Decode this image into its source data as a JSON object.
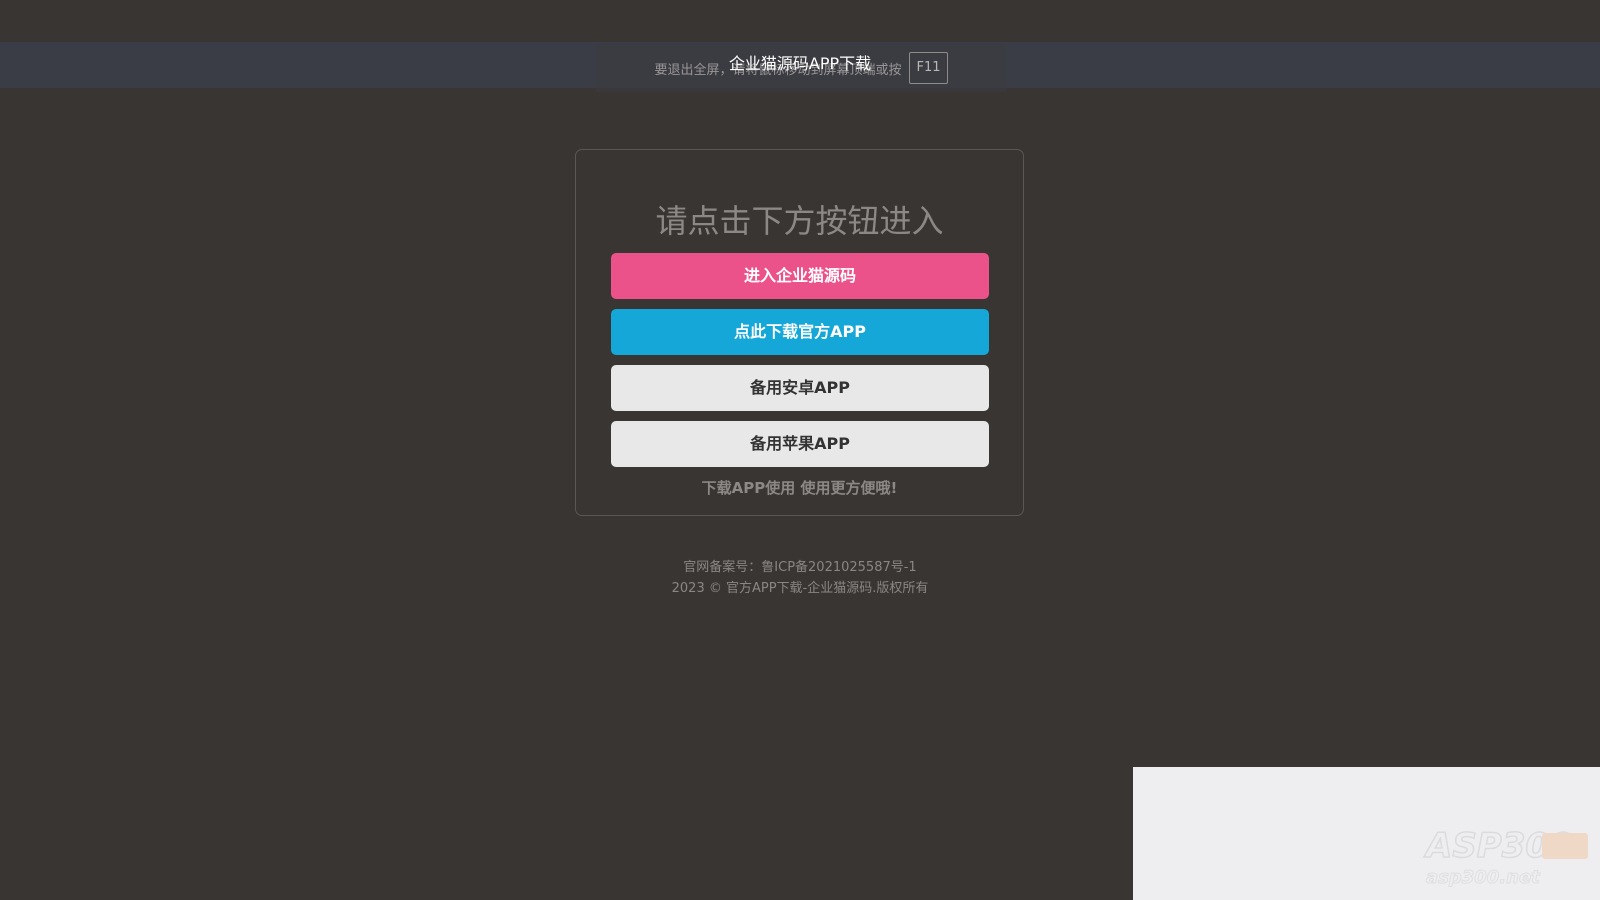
{
  "header": {
    "title": "企业猫源码APP下载"
  },
  "fullscreen_hint": {
    "text": "要退出全屏，请将鼠标移动到屏幕顶端或按",
    "key": "F11"
  },
  "card": {
    "heading": "请点击下方按钮进入",
    "buttons": {
      "enter": "进入企业猫源码",
      "download": "点此下载官方APP",
      "android": "备用安卓APP",
      "ios": "备用苹果APP"
    },
    "tip": "下载APP使用 使用更方便哦!"
  },
  "footer": {
    "icp": "官网备案号：鲁ICP备2021025587号-1",
    "copyright": "2023 © 官方APP下载-企业猫源码.版权所有"
  },
  "colors": {
    "background": "#383533",
    "enter_button": "#ec528a",
    "download_button": "#15a7d7",
    "secondary_button": "#e8e8e8"
  }
}
